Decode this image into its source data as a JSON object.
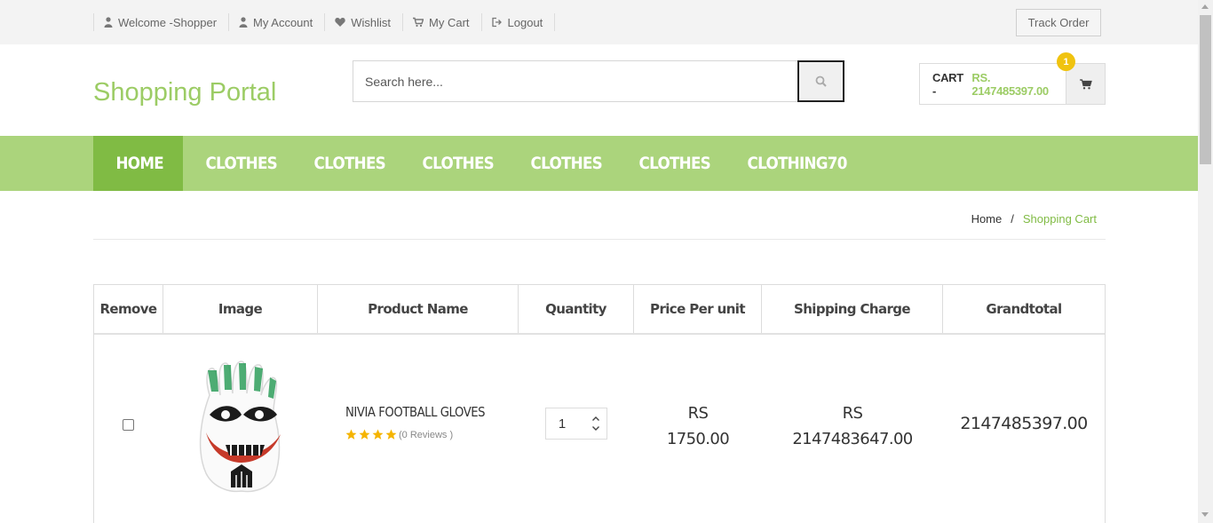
{
  "top_links": [
    {
      "icon": "user-icon",
      "label": "Welcome -Shopper"
    },
    {
      "icon": "user-icon",
      "label": "My Account"
    },
    {
      "icon": "heart-icon",
      "label": "Wishlist"
    },
    {
      "icon": "cart-icon",
      "label": "My Cart"
    },
    {
      "icon": "logout-icon",
      "label": "Logout"
    }
  ],
  "track_order": "Track Order",
  "logo": "Shopping Portal",
  "search": {
    "placeholder": "Search here...",
    "icon": "search-icon"
  },
  "cart": {
    "label": "CART -",
    "amount": "RS. 2147485397.00",
    "count": "1",
    "icon": "cart-icon"
  },
  "nav": [
    "HOME",
    "CLOTHES",
    "CLOTHES",
    "CLOTHES",
    "CLOTHES",
    "CLOTHES",
    "CLOTHING70"
  ],
  "breadcrumb": {
    "home": "Home",
    "separator": "/",
    "current": "Shopping Cart"
  },
  "table": {
    "headers": [
      "Remove",
      "Image",
      "Product Name",
      "Quantity",
      "Price Per unit",
      "Shipping Charge",
      "Grandtotal"
    ],
    "rows": [
      {
        "product_name": "NIVIA FOOTBALL GLOVES",
        "rating_stars": 4,
        "reviews": "(0 Reviews )",
        "quantity": "1",
        "price_currency": "RS",
        "price": "1750.00",
        "shipping_currency": "RS",
        "shipping": "2147483647.00",
        "grandtotal": "2147485397.00"
      }
    ]
  },
  "colors": {
    "accent": "#9ccc65",
    "nav_bg": "#abd47c",
    "nav_active": "#80bb44",
    "badge": "#f0c30f"
  }
}
